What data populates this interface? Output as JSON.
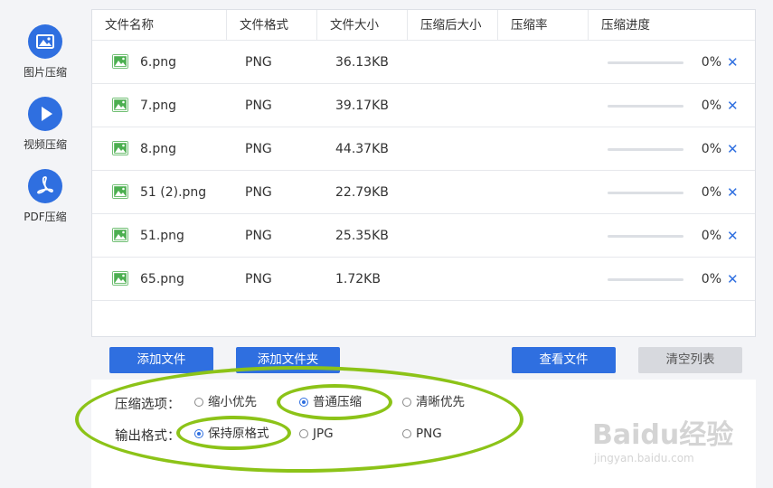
{
  "sidebar": {
    "items": [
      {
        "label": "图片压缩",
        "icon": "image-icon"
      },
      {
        "label": "视频压缩",
        "icon": "play-icon"
      },
      {
        "label": "PDF压缩",
        "icon": "pdf-icon"
      }
    ]
  },
  "table": {
    "columns": [
      "文件名称",
      "文件格式",
      "文件大小",
      "压缩后大小",
      "压缩率",
      "压缩进度"
    ],
    "rows": [
      {
        "name": "6.png",
        "format": "PNG",
        "size": "36.13KB",
        "compressed_size": "",
        "ratio": "",
        "progress": 0,
        "progress_text": "0%"
      },
      {
        "name": "7.png",
        "format": "PNG",
        "size": "39.17KB",
        "compressed_size": "",
        "ratio": "",
        "progress": 0,
        "progress_text": "0%"
      },
      {
        "name": "8.png",
        "format": "PNG",
        "size": "44.37KB",
        "compressed_size": "",
        "ratio": "",
        "progress": 0,
        "progress_text": "0%"
      },
      {
        "name": "51 (2).png",
        "format": "PNG",
        "size": "22.79KB",
        "compressed_size": "",
        "ratio": "",
        "progress": 0,
        "progress_text": "0%"
      },
      {
        "name": "51.png",
        "format": "PNG",
        "size": "25.35KB",
        "compressed_size": "",
        "ratio": "",
        "progress": 0,
        "progress_text": "0%"
      },
      {
        "name": "65.png",
        "format": "PNG",
        "size": "1.72KB",
        "compressed_size": "",
        "ratio": "",
        "progress": 0,
        "progress_text": "0%"
      }
    ],
    "delete_glyph": "✕"
  },
  "buttons": {
    "add_file": "添加文件",
    "add_folder": "添加文件夹",
    "view_files": "查看文件",
    "clear_list": "清空列表"
  },
  "options": {
    "compression_label": "压缩选项：",
    "compression_choices": [
      {
        "label": "缩小优先",
        "checked": false
      },
      {
        "label": "普通压缩",
        "checked": true
      },
      {
        "label": "清晰优先",
        "checked": false
      }
    ],
    "output_label": "输出格式：",
    "output_choices": [
      {
        "label": "保持原格式",
        "checked": true
      },
      {
        "label": "JPG",
        "checked": false
      },
      {
        "label": "PNG",
        "checked": false
      }
    ]
  },
  "colors": {
    "accent": "#2f6fe0",
    "annotation": "#8cc318",
    "file_icon": "#4caf50"
  },
  "watermark": {
    "main": "Baidu经验",
    "sub": "jingyan.baidu.com"
  }
}
